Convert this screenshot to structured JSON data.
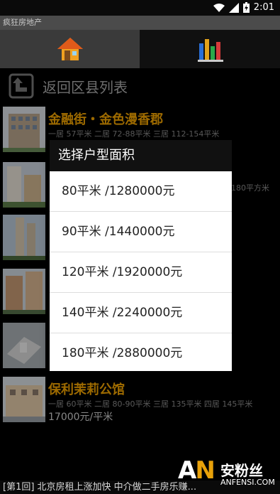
{
  "status": {
    "time": "2:01"
  },
  "window": {
    "title": "疯狂房地产"
  },
  "tabs": [
    {
      "name": "home",
      "icon": "house-icon",
      "active": true
    },
    {
      "name": "stats",
      "icon": "bar-chart-icon",
      "active": false
    }
  ],
  "back": {
    "label": "返回区县列表"
  },
  "listings": [
    {
      "name": "金融街・金色漫香郡",
      "layouts": "一居 57平米 二居 72-88平米 三居 112-154平米",
      "price": ""
    },
    {
      "name": "",
      "layouts": "",
      "price": "",
      "tail": "180平方米"
    },
    {
      "name": "",
      "layouts": "",
      "price": ""
    },
    {
      "name": "",
      "layouts": "",
      "price": ""
    },
    {
      "name": "",
      "layouts": "",
      "price": ""
    },
    {
      "name": "保利茉莉公馆",
      "layouts": "一居 60平米 二居 80-90平米 三居 135平米 四居 145平米",
      "price": "17000元/平米"
    }
  ],
  "dialog": {
    "title": "选择户型面积",
    "options": [
      "80平米 /1280000元",
      "90平米 /1440000元",
      "120平米 /1920000元",
      "140平米 /2240000元",
      "180平米 /2880000元"
    ]
  },
  "ticker": {
    "text": "[第1回] 北京房租上涨加快 中介做二手房乐赚..."
  },
  "watermark": {
    "logo": "AN",
    "cn": "安粉丝",
    "en": "ANFENSI.COM"
  }
}
